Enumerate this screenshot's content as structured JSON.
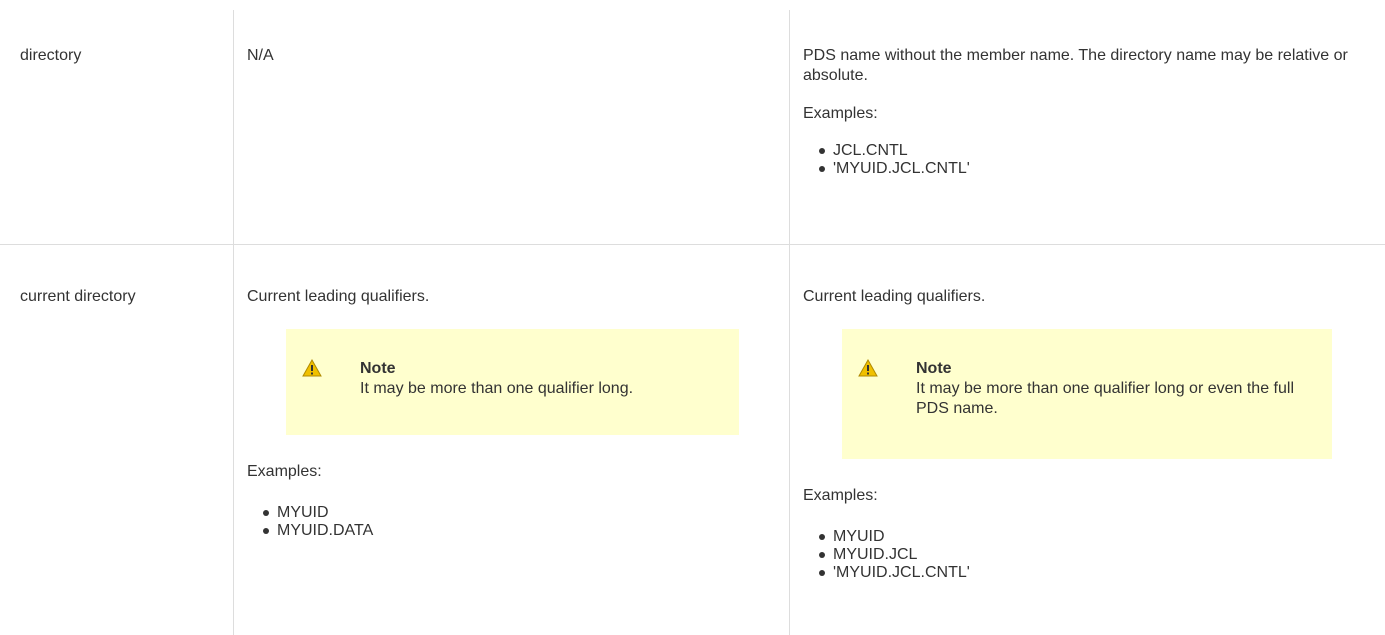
{
  "rows": [
    {
      "name": "directory",
      "default": "N/A",
      "description": {
        "text": "PDS name without the member name. The directory name may be relative or absolute.",
        "examples_label": "Examples:",
        "examples": [
          "JCL.CNTL",
          "'MYUID.JCL.CNTL'"
        ]
      }
    },
    {
      "name": "current directory",
      "default": {
        "text": "Current leading qualifiers.",
        "note_title": "Note",
        "note_body": "It may be more than one qualifier long.",
        "examples_label": "Examples:",
        "examples": [
          "MYUID",
          "MYUID.DATA"
        ]
      },
      "description": {
        "text": "Current leading qualifiers.",
        "note_title": "Note",
        "note_body": "It may be more than one qualifier long or even the full PDS name.",
        "examples_label": "Examples:",
        "examples": [
          "MYUID",
          "MYUID.JCL",
          "'MYUID.JCL.CNTL'"
        ]
      }
    }
  ],
  "icons": {
    "note": "warning-icon"
  },
  "colors": {
    "note_bg": "#ffffce",
    "border": "#dddddd",
    "warning": "#f0c000"
  }
}
